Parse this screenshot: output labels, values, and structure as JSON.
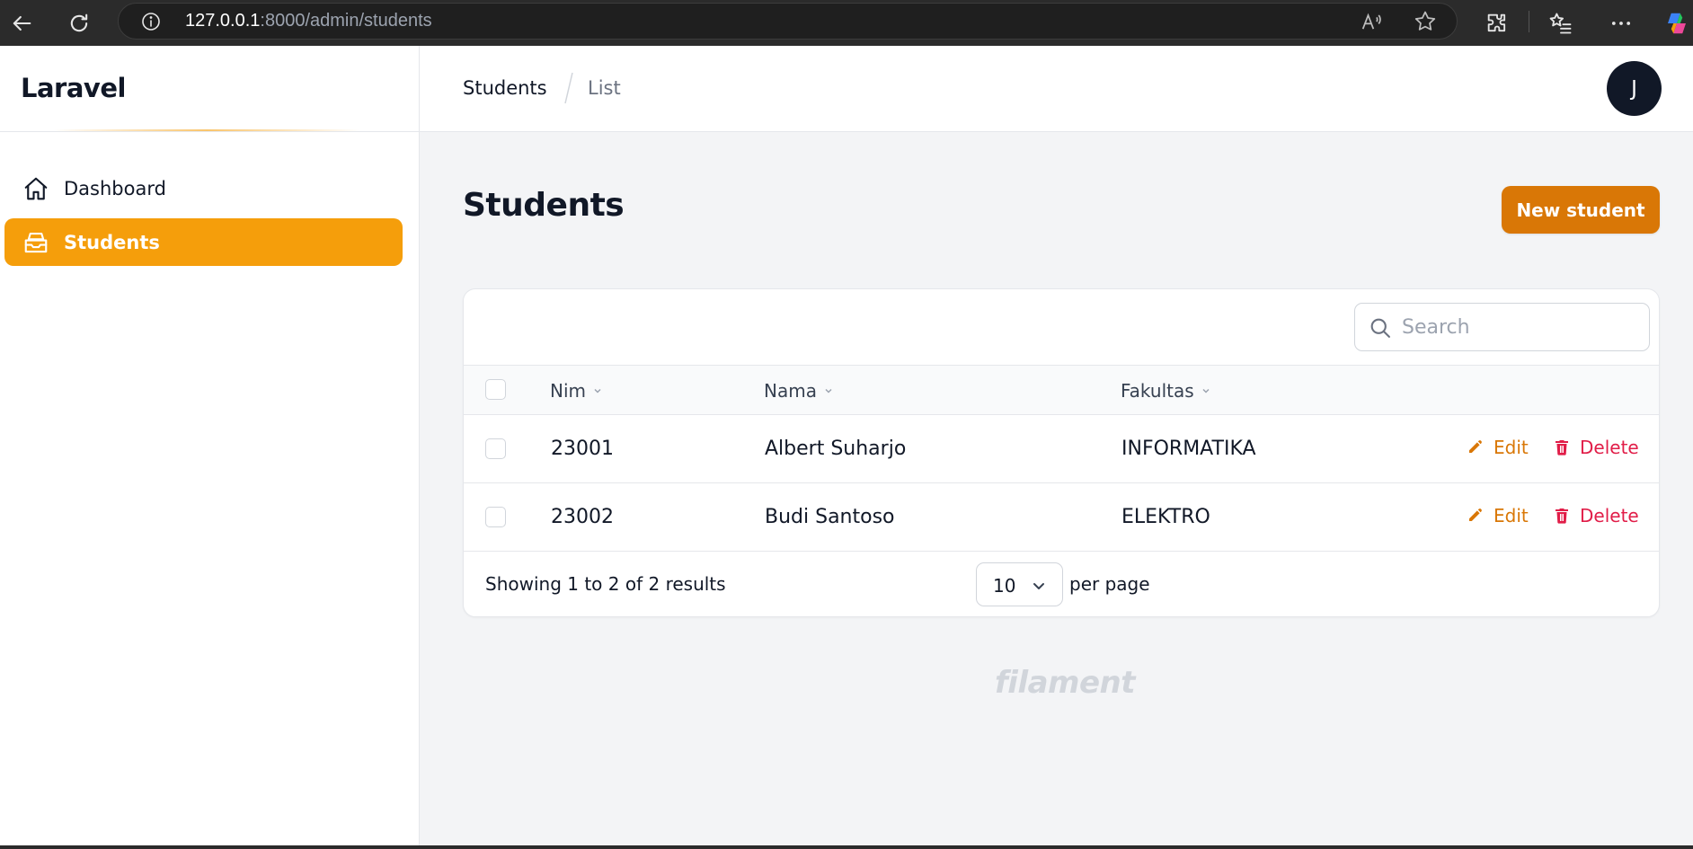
{
  "browser": {
    "url_host": "127.0.0.1",
    "url_path": ":8000/admin/students",
    "icons": [
      "back-icon",
      "refresh-icon",
      "info-icon",
      "read-aloud-icon",
      "favorite-star-icon",
      "extensions-icon",
      "favorites-list-icon",
      "more-icon",
      "copilot-icon"
    ]
  },
  "sidebar": {
    "brand": "Laravel",
    "items": [
      {
        "label": "Dashboard",
        "icon": "home-icon",
        "active": false
      },
      {
        "label": "Students",
        "icon": "inbox-stack-icon",
        "active": true
      }
    ]
  },
  "topbar": {
    "breadcrumbs": [
      "Students",
      "List"
    ],
    "avatar_initial": "J"
  },
  "page": {
    "title": "Students",
    "new_button": "New student"
  },
  "table": {
    "search_placeholder": "Search",
    "columns": [
      "Nim",
      "Nama",
      "Fakultas"
    ],
    "rows": [
      {
        "nim": "23001",
        "nama": "Albert Suharjo",
        "fakultas": "INFORMATIKA"
      },
      {
        "nim": "23002",
        "nama": "Budi Santoso",
        "fakultas": "ELEKTRO"
      }
    ],
    "actions": {
      "edit": "Edit",
      "delete": "Delete"
    },
    "footer": {
      "showing": "Showing 1 to 2 of 2 results",
      "per_page_value": "10",
      "per_page_label": "per page"
    }
  },
  "footer": {
    "logo_text": "filament"
  },
  "colors": {
    "primary": "#f59e0b",
    "primary_dark": "#d97706",
    "danger": "#e11d48",
    "sidebar_bg": "#ffffff",
    "main_bg": "#f3f4f6"
  }
}
